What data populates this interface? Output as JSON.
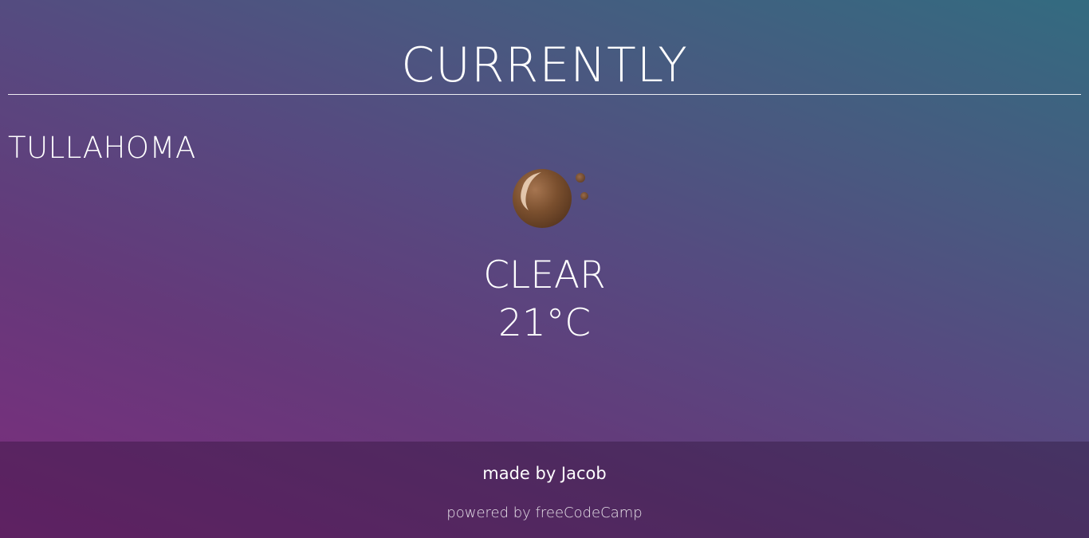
{
  "header": {
    "title": "CURRENTLY"
  },
  "location": {
    "city": "TULLAHOMA"
  },
  "weather": {
    "icon": "moon-icon",
    "condition": "CLEAR",
    "temperature": "21°C"
  },
  "footer": {
    "credit": "made by Jacob",
    "powered_by": "powered by freeCodeCamp"
  },
  "colors": {
    "gradient_start": "#7d2d7e",
    "gradient_end": "#336b80",
    "moon": "#7a4f2e",
    "text": "#ffffff"
  }
}
